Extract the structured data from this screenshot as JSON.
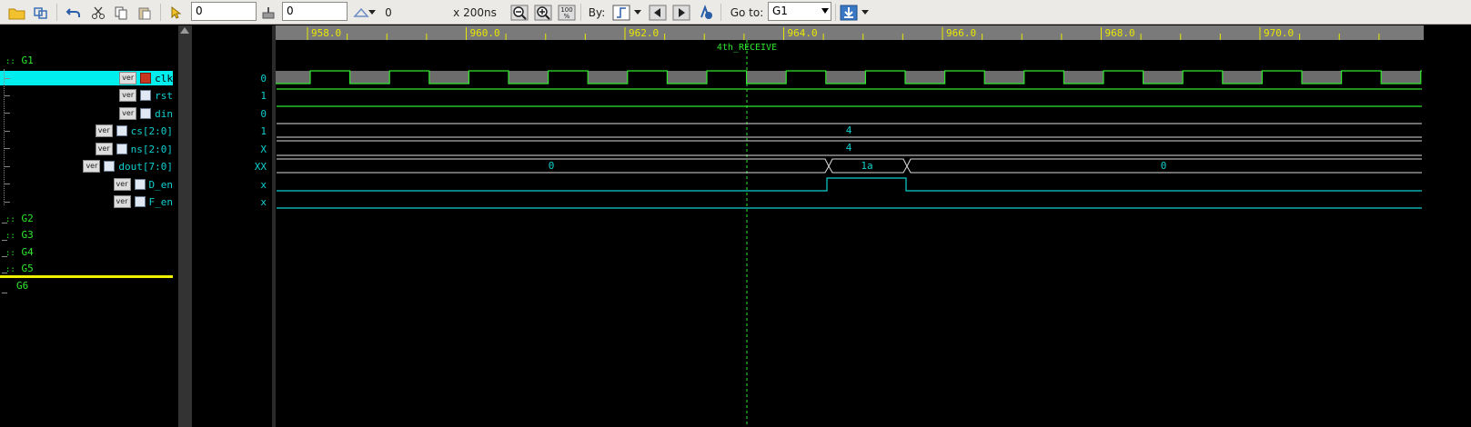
{
  "toolbar": {
    "time_input": "0",
    "offset_input": "0",
    "delta_value": "0",
    "scale": "x 200ns",
    "zoom_fit_label": "100\n%",
    "by_label": "By:",
    "goto_label": "Go to:",
    "goto_value": "G1"
  },
  "ruler": {
    "ticks": [
      "958.0",
      "960.0",
      "962.0",
      "964.0",
      "966.0",
      "968.0",
      "970.0"
    ]
  },
  "marker": {
    "label": "4th_RECEIVE"
  },
  "groups": [
    "G1",
    "G2",
    "G3",
    "G4",
    "G5",
    "G6"
  ],
  "signals": [
    {
      "name": "clk",
      "badge": "ver",
      "value": "0"
    },
    {
      "name": "rst",
      "badge": "ver",
      "value": "1"
    },
    {
      "name": "din",
      "badge": "ver",
      "value": "0"
    },
    {
      "name": "cs[2:0]",
      "badge": "ver",
      "value": "1"
    },
    {
      "name": "ns[2:0]",
      "badge": "ver",
      "value": "X"
    },
    {
      "name": "dout[7:0]",
      "badge": "ver",
      "value": "XX"
    },
    {
      "name": "D_en",
      "badge": "ver",
      "value": "x"
    },
    {
      "name": "F_en",
      "badge": "ver",
      "value": "x"
    }
  ],
  "bus_values": {
    "cs": "4",
    "ns": "4",
    "dout_a": "0",
    "dout_b": "1a",
    "dout_c": "0"
  },
  "colors": {
    "ruler_bg": "#7a7a7a",
    "ruler_text": "#e8e800",
    "wave_green": "#2ee82e",
    "wave_cyan": "#0fd0d0",
    "clk_fill": "#6c6c6c",
    "selected": "#00eeee",
    "g6_line": "#f0f000"
  }
}
